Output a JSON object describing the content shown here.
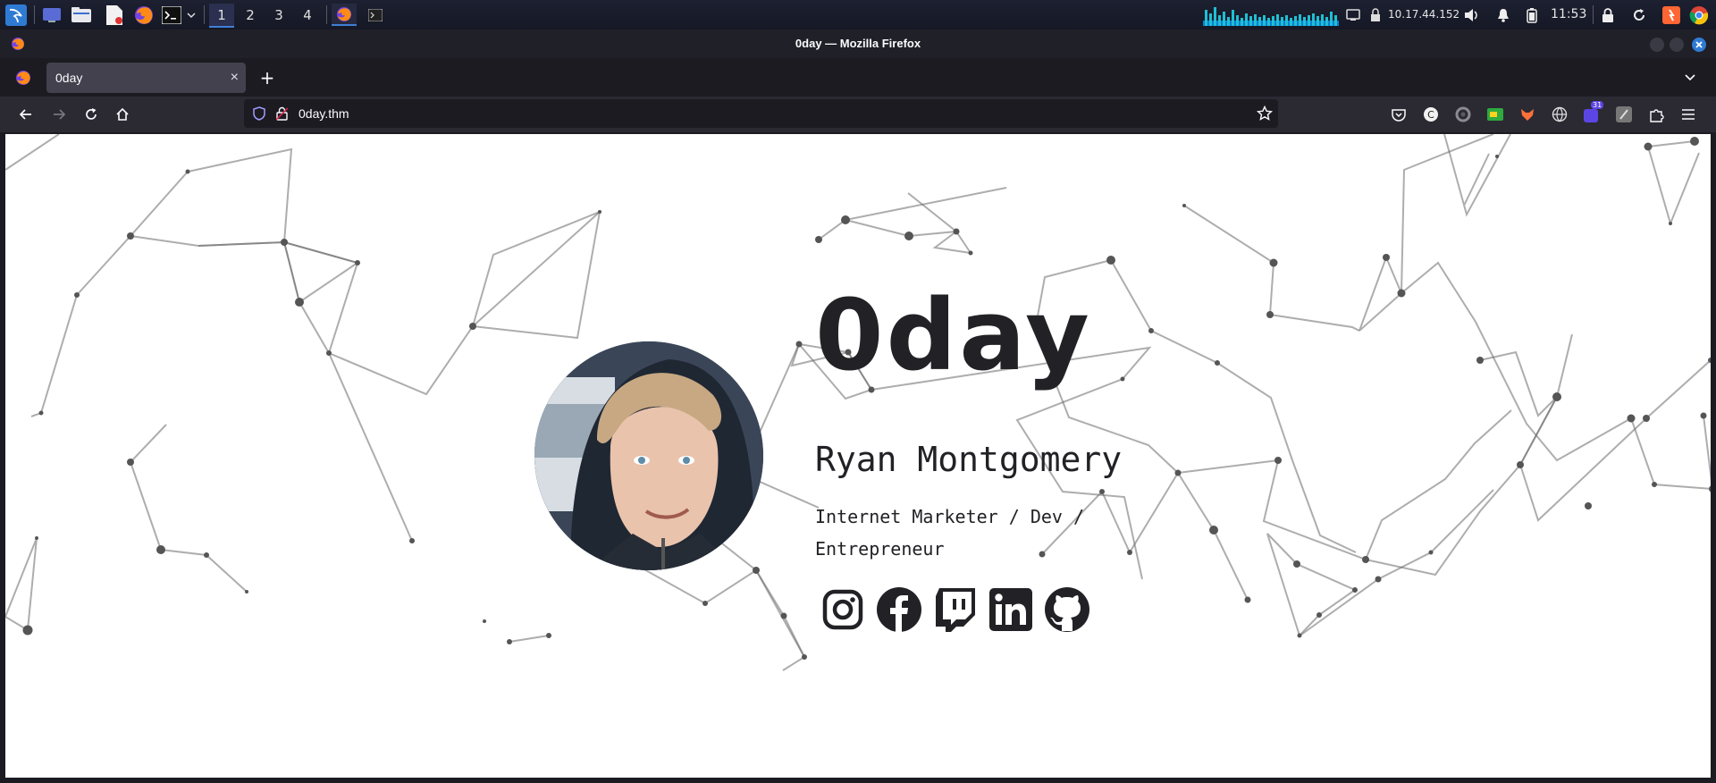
{
  "taskbar": {
    "workspaces": [
      "1",
      "2",
      "3",
      "4"
    ],
    "network_ip": "10.17.44.152",
    "clock": "11:53",
    "icons": [
      "kali-menu-icon",
      "desktop-icon",
      "file-manager-icon",
      "text-editor-icon",
      "firefox-icon",
      "terminal-icon",
      "chevron-down-icon",
      "firefox-window-icon",
      "terminal-window-icon",
      "network-graph-icon",
      "monitor-icon",
      "network-icon",
      "volume-icon",
      "bell-icon",
      "battery-icon",
      "lock-icon",
      "refresh-icon",
      "burp-icon",
      "chrome-icon"
    ]
  },
  "window": {
    "title": "0day — Mozilla Firefox"
  },
  "browser": {
    "tab_title": "0day",
    "new_tab_label": "+",
    "close_tab_label": "×",
    "url": "0day.thm",
    "extension_badge": "31"
  },
  "page": {
    "title": "0day",
    "name": "Ryan Montgomery",
    "tagline": "Internet Marketer / Dev / Entrepreneur",
    "social_links": [
      "instagram-icon",
      "facebook-icon",
      "twitch-icon",
      "linkedin-icon",
      "github-icon"
    ]
  },
  "colors": {
    "accent": "#3f7fd6",
    "text_dark": "#222226",
    "page_bg": "#ffffff",
    "browser_chrome": "#2b2a33"
  }
}
